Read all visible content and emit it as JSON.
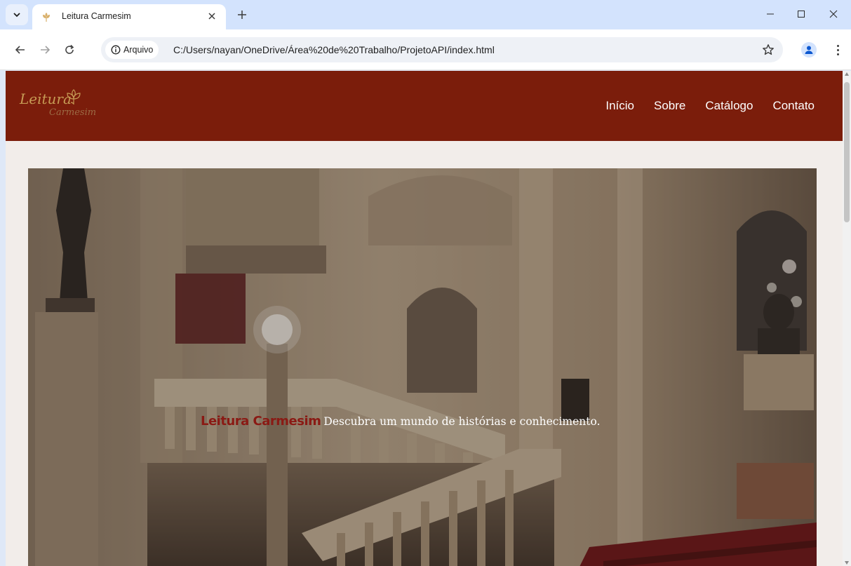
{
  "browser": {
    "tab": {
      "title": "Leitura Carmesim",
      "favicon": "flower-icon"
    },
    "toolbar": {
      "site_chip_label": "Arquivo",
      "url": "C:/Users/nayan/OneDrive/Área%20de%20Trabalho/ProjetoAPI/index.html"
    }
  },
  "site": {
    "logo": {
      "line1": "Leitura",
      "line2": "Carmesim"
    },
    "nav": [
      {
        "label": "Início"
      },
      {
        "label": "Sobre"
      },
      {
        "label": "Catálogo"
      },
      {
        "label": "Contato"
      }
    ],
    "hero": {
      "brand": "Leitura Carmesim",
      "tagline": "Descubra um mundo de histórias e conhecimento."
    }
  },
  "colors": {
    "header_bg": "#7b1d0b",
    "page_bg": "#f2edea",
    "logo_gold": "#c69b55",
    "hero_brand": "#8a1a14",
    "tabstrip_bg": "#d3e3fd"
  }
}
